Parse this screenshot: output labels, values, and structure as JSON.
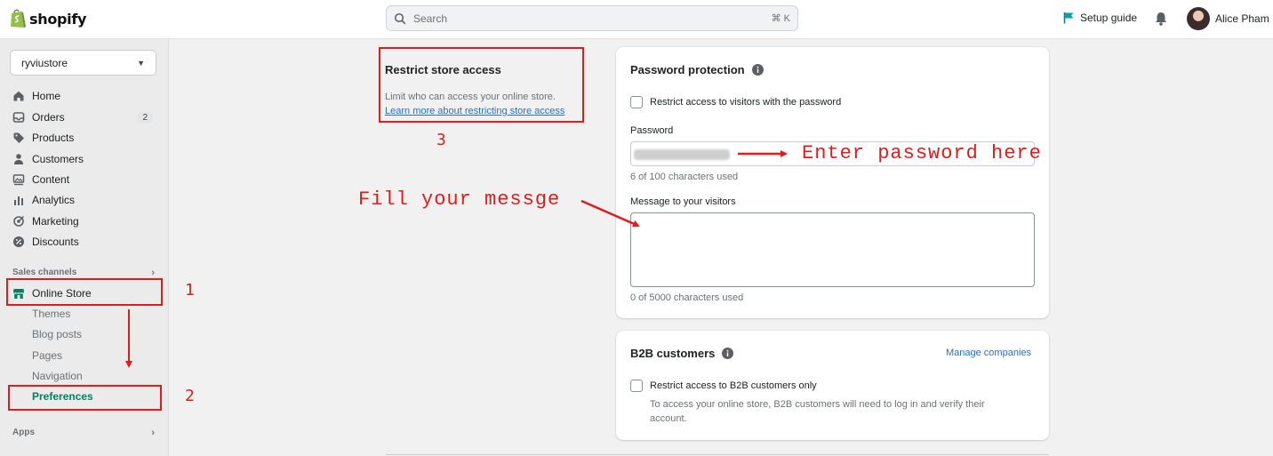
{
  "brand": {
    "name": "shopify",
    "color": "#95bf47"
  },
  "search": {
    "placeholder": "Search",
    "shortcut": "⌘ K"
  },
  "header": {
    "setup_guide": "Setup guide",
    "user_name": "Alice Pham"
  },
  "sidebar": {
    "store_name": "ryviustore",
    "items": [
      {
        "label": "Home",
        "icon": "home-icon"
      },
      {
        "label": "Orders",
        "icon": "orders-icon",
        "badge": "2"
      },
      {
        "label": "Products",
        "icon": "tag-icon"
      },
      {
        "label": "Customers",
        "icon": "person-icon"
      },
      {
        "label": "Content",
        "icon": "content-icon"
      },
      {
        "label": "Analytics",
        "icon": "chart-icon"
      },
      {
        "label": "Marketing",
        "icon": "target-icon"
      },
      {
        "label": "Discounts",
        "icon": "discount-icon"
      }
    ],
    "sales_channels_title": "Sales channels",
    "online_store": "Online Store",
    "sub_items": [
      "Themes",
      "Blog posts",
      "Pages",
      "Navigation",
      "Preferences"
    ],
    "apps_title": "Apps"
  },
  "restrict": {
    "title": "Restrict store access",
    "description": "Limit who can access your online store.",
    "link": "Learn more about restricting store access"
  },
  "password_card": {
    "title": "Password protection",
    "checkbox_label": "Restrict access to visitors with the password",
    "password_label": "Password",
    "password_help": "6 of 100 characters used",
    "message_label": "Message to your visitors",
    "message_value": "",
    "message_help": "0 of 5000 characters used"
  },
  "b2b_card": {
    "title": "B2B customers",
    "manage_link": "Manage companies",
    "checkbox_label": "Restrict access to B2B customers only",
    "description": "To access your online store, B2B customers will need to log in and verify their account."
  },
  "annotations": {
    "num1": "1",
    "num2": "2",
    "num3": "3",
    "password_hint": "Enter password here",
    "message_hint": "Fill your messge",
    "color": "#e01b1b"
  }
}
